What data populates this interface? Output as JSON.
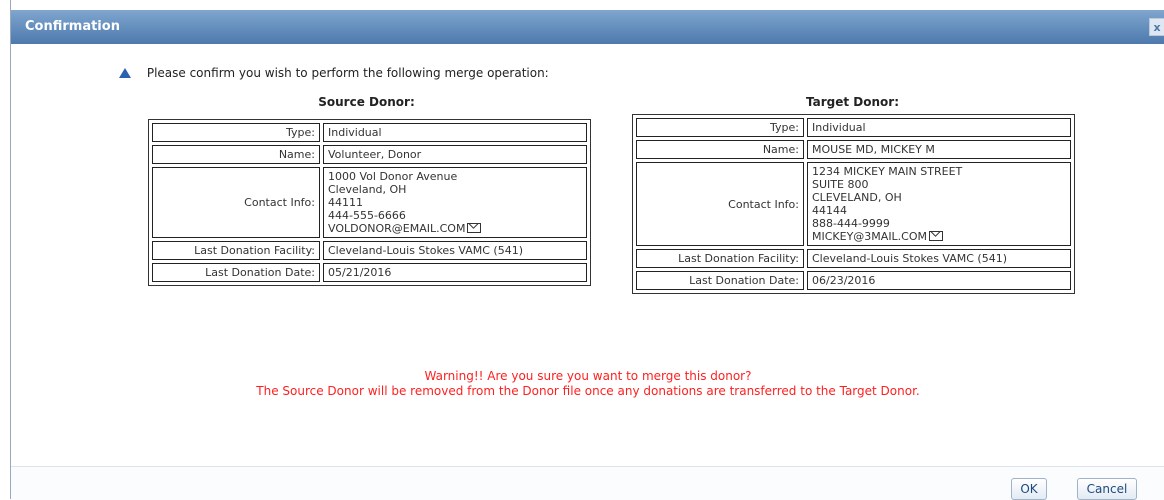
{
  "dialog": {
    "title": "Confirmation",
    "close_label": "x"
  },
  "message": "Please confirm you wish to perform the following merge operation:",
  "source": {
    "heading": "Source Donor:",
    "type_label": "Type:",
    "type": "Individual",
    "name_label": "Name:",
    "name": "Volunteer, Donor",
    "contact_label": "Contact Info:",
    "contact": [
      "1000 Vol Donor Avenue",
      "Cleveland, OH",
      "44111",
      "444-555-6666"
    ],
    "email": "VOLDONOR@EMAIL.COM",
    "facility_label": "Last Donation Facility:",
    "facility": "Cleveland-Louis Stokes VAMC (541)",
    "date_label": "Last Donation Date:",
    "date": "05/21/2016"
  },
  "target": {
    "heading": "Target Donor:",
    "type_label": "Type:",
    "type": "Individual",
    "name_label": "Name:",
    "name": "MOUSE MD, MICKEY M",
    "contact_label": "Contact Info:",
    "contact": [
      "1234 MICKEY MAIN STREET",
      "SUITE 800",
      "CLEVELAND, OH",
      "44144",
      "888-444-9999"
    ],
    "email": "MICKEY@3MAIL.COM",
    "facility_label": "Last Donation Facility:",
    "facility": "Cleveland-Louis Stokes VAMC (541)",
    "date_label": "Last Donation Date:",
    "date": "06/23/2016"
  },
  "warning": {
    "line1": "Warning!! Are you sure you want to merge this donor?",
    "line2": "The Source Donor will be removed from the Donor file once any donations are transferred to the Target Donor."
  },
  "buttons": {
    "ok": "OK",
    "cancel": "Cancel"
  }
}
